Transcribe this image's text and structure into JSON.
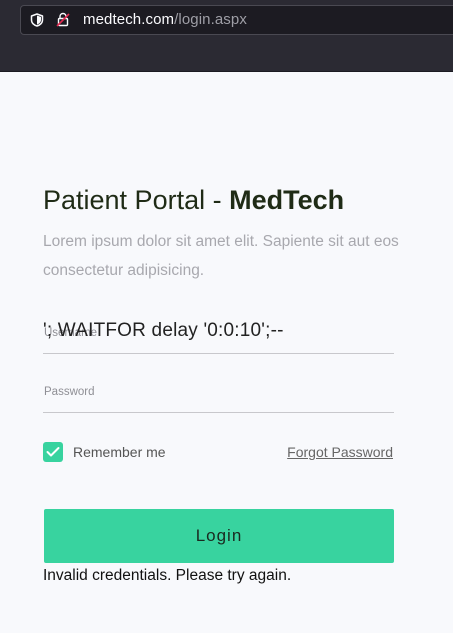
{
  "browser": {
    "url_domain": "medtech.com",
    "url_path": "/login.aspx"
  },
  "portal": {
    "title_prefix": "Patient Portal - ",
    "title_brand": "MedTech",
    "subtitle": "Lorem ipsum dolor sit amet elit. Sapiente sit aut eos consectetur adipisicing."
  },
  "form": {
    "username_label": "Username",
    "username_value": "'; WAITFOR delay '0:0:10';--",
    "password_label": "Password",
    "password_value": "",
    "remember_label": "Remember me",
    "remember_checked": true,
    "forgot_label": "Forgot Password",
    "login_label": "Login",
    "error_message": "Invalid credentials. Please try again."
  },
  "colors": {
    "accent": "#38d39f",
    "chrome": "#2b2a33",
    "title": "#1f2b16"
  },
  "icons": {
    "tracking": "shield-icon",
    "connection": "lock-icon",
    "checkbox": "check-icon"
  }
}
